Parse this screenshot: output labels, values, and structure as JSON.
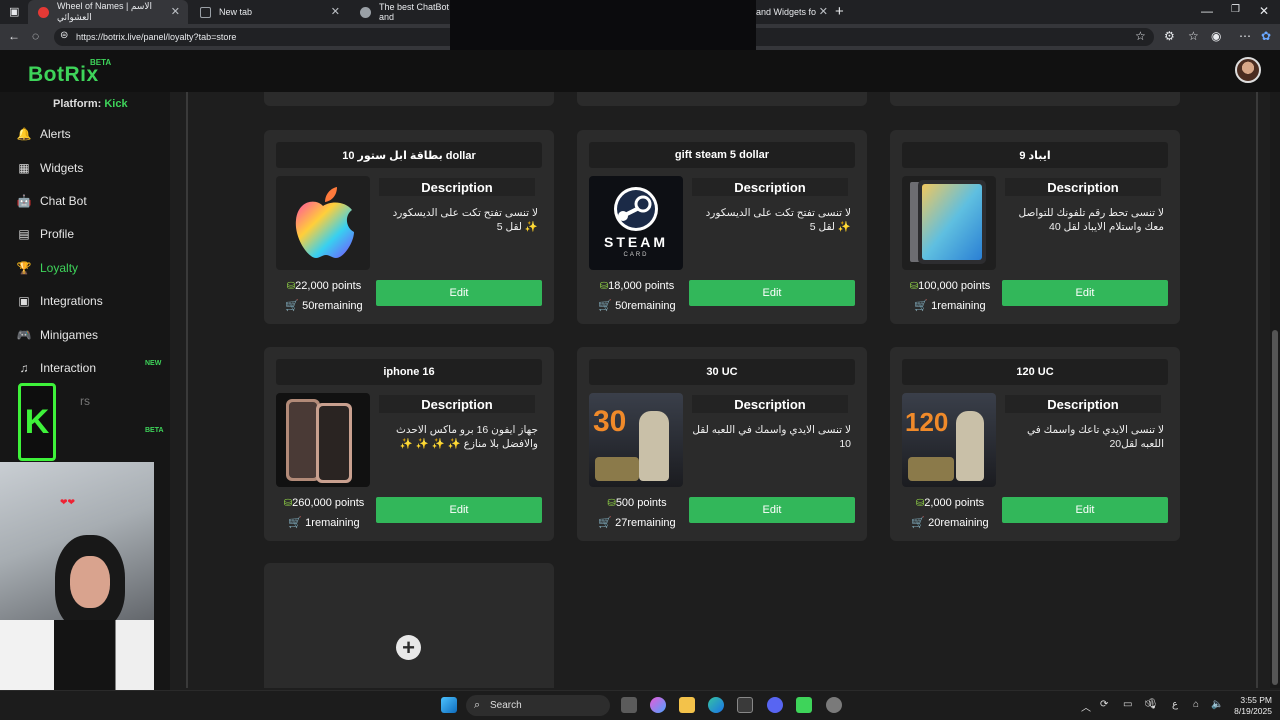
{
  "browser": {
    "tabs": [
      {
        "label": "Wheel of Names | الاسم العشوائي",
        "fav_color": "#e53935"
      },
      {
        "label": "New tab",
        "fav_color": "#5f6368"
      },
      {
        "label": "The best ChatBot and",
        "fav_color": "#5f6368"
      },
      {
        "label": "and Widgets fo",
        "fav_color": "#3ed45a"
      }
    ],
    "new_tab": "+",
    "url": "https://botrix.live/panel/loyalty?tab=store"
  },
  "app": {
    "logo": "BotRix",
    "logo_badge": "BETA",
    "platform_label": "Platform:",
    "platform_value": "Kick",
    "accent": "#3ed45a"
  },
  "sidebar": {
    "items": [
      {
        "label": "Alerts",
        "icon": "bell-icon",
        "glyph": "🔔"
      },
      {
        "label": "Widgets",
        "icon": "grid-icon",
        "glyph": "▦"
      },
      {
        "label": "Chat Bot",
        "icon": "robot-icon",
        "glyph": "🤖"
      },
      {
        "label": "Profile",
        "icon": "id-card-icon",
        "glyph": "▤"
      },
      {
        "label": "Loyalty",
        "icon": "trophy-icon",
        "glyph": "🏆"
      },
      {
        "label": "Integrations",
        "icon": "plugin-icon",
        "glyph": "▣"
      },
      {
        "label": "Minigames",
        "icon": "gamepad-icon",
        "glyph": "🎮"
      },
      {
        "label": "Interaction",
        "icon": "music-note-icon",
        "glyph": "♫"
      }
    ],
    "partial_label": "rs",
    "tag_new": "NEW",
    "tag_beta": "BETA"
  },
  "store": {
    "description_header": "Description",
    "edit_label": "Edit",
    "items": [
      {
        "title": "بطاقة ابل ستور 10 dollar",
        "description": "لا تنسى تفتح تكت على الديسكورد ✨ لقل 5",
        "points": "22,000 points",
        "remaining": "50remaining",
        "image": "apple-logo-image"
      },
      {
        "title": "gift steam 5 dollar",
        "description": "لا تنسى تفتح تكت على الديسكورد ✨ لقل 5",
        "points": "18,000 points",
        "remaining": "50remaining",
        "image": "steam-card-image",
        "image_text": "STEAM",
        "image_sub": "CARD"
      },
      {
        "title": "ايباد 9",
        "description": "لا تنسى تحط رقم تلفونك للتواصل معك واستلام الايباد لقل 40",
        "points": "100,000 points",
        "remaining": "1remaining",
        "image": "ipad-image"
      },
      {
        "title": "iphone 16",
        "description": "جهاز ايفون 16 برو ماكس الاحدث والافضل بلا منازع ✨ ✨ ✨ ✨",
        "points": "260,000 points",
        "remaining": "1remaining",
        "image": "iphone-image"
      },
      {
        "title": "30 UC",
        "description": "لا تنسى الايدي واسمك في اللعبه لقل 10",
        "points": "500 points",
        "remaining": "27remaining",
        "image": "pubg-30uc-image",
        "image_text": "30"
      },
      {
        "title": "120 UC",
        "description": "لا تنسى الايدي تاعك واسمك في اللعبه لقل20",
        "points": "2,000 points",
        "remaining": "20remaining",
        "image": "pubg-120uc-image",
        "image_text": "120"
      }
    ],
    "add_icon": "+"
  },
  "taskbar": {
    "search": "Search",
    "time": "3:55 PM",
    "date": "8/19/2025",
    "lang": "ع"
  }
}
